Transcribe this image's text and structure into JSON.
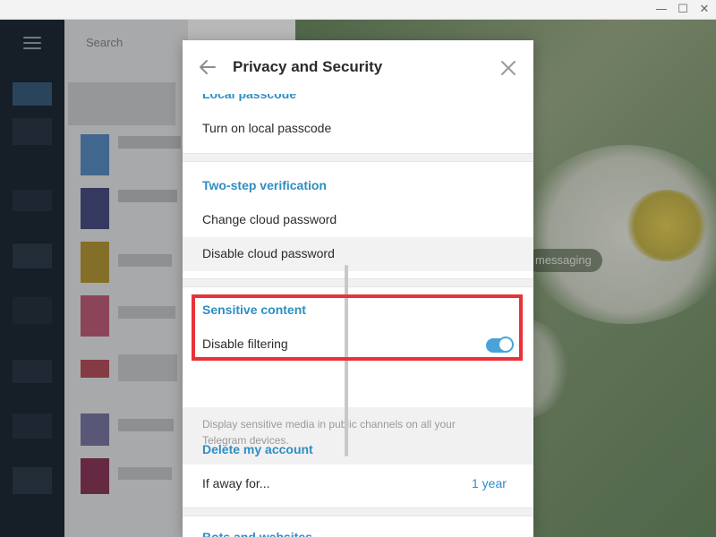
{
  "window": {
    "minimize_glyph": "—",
    "maximize_glyph": "☐",
    "close_glyph": "✕"
  },
  "sidebar": {
    "search_placeholder": "Search"
  },
  "background": {
    "message_pill": "messaging"
  },
  "dialog": {
    "title": "Privacy and Security",
    "sections": {
      "local_passcode": {
        "title": "Local passcode",
        "rows": [
          "Turn on local passcode"
        ]
      },
      "two_step": {
        "title": "Two-step verification",
        "rows": [
          "Change cloud password",
          "Disable cloud password"
        ]
      },
      "sensitive": {
        "title": "Sensitive content",
        "toggle_label": "Disable filtering",
        "toggle_on": true,
        "hint": "Display sensitive media in public channels on all your Telegram devices."
      },
      "delete_account": {
        "title": "Delete my account",
        "row_label": "If away for...",
        "row_value": "1 year"
      },
      "bots": {
        "title": "Bots and websites"
      }
    }
  },
  "colors": {
    "accent": "#2e8ec2",
    "toggle": "#4aa3d8",
    "highlight": "#e8323a"
  }
}
